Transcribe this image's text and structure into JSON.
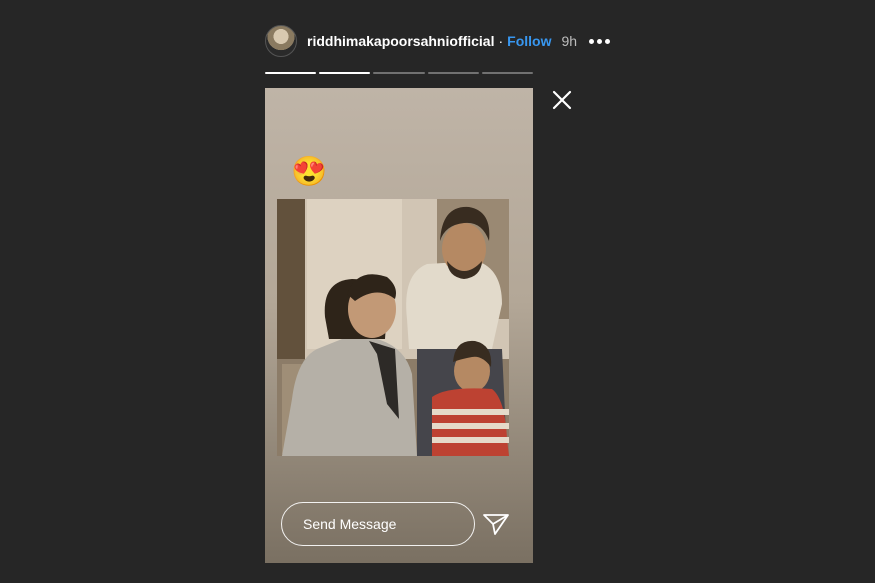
{
  "header": {
    "username": "riddhimakapoorsahniofficial",
    "separator": "·",
    "follow_label": "Follow",
    "time": "9h",
    "avatar": "profile-avatar",
    "more_icon": "more-options-icon"
  },
  "progress": {
    "segments": 5,
    "completed": 2
  },
  "story": {
    "sticker": "😍",
    "photo": "family-photo",
    "reply_placeholder": "Send Message",
    "send_icon": "paper-plane-icon",
    "close_icon": "close-icon"
  },
  "colors": {
    "background": "#262626",
    "accent": "#3897f0",
    "text": "#ffffff"
  }
}
